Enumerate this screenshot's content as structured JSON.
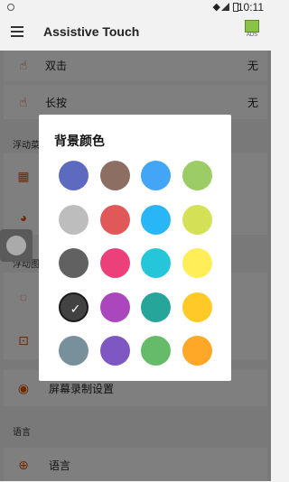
{
  "status_bar": {
    "time": "10:11",
    "wifi_icon": "wifi-icon",
    "battery_icon": "battery-icon"
  },
  "app_bar": {
    "title": "Assistive Touch",
    "menu_icon": "hamburger-icon",
    "ads_label": "ADS"
  },
  "settings": {
    "rows": [
      {
        "label": "双击",
        "value": "无",
        "icon": "hand-icon"
      },
      {
        "label": "长按",
        "value": "无",
        "icon": "hand-icon"
      }
    ],
    "section_float_menu": "浮动菜",
    "section_float_icon": "浮动图",
    "record_row": {
      "label": "屏幕录制设置",
      "icon": "record-icon"
    },
    "section_language": "语言",
    "language_row": {
      "label": "语言",
      "icon": "globe-icon"
    }
  },
  "dialog": {
    "title": "背景颜色",
    "colors": [
      [
        "#5c6bc0",
        "#8d6e63",
        "#42a5f5",
        "#9ccc65"
      ],
      [
        "#bdbdbd",
        "#e05858",
        "#29b6f6",
        "#d4e157"
      ],
      [
        "#616161",
        "#ec407a",
        "#26c6da",
        "#ffee58"
      ],
      [
        "#424242",
        "#ab47bc",
        "#26a69a",
        "#ffca28"
      ],
      [
        "#78909c",
        "#7e57c2",
        "#66bb6a",
        "#ffa726"
      ]
    ],
    "selected_check": "✓"
  }
}
